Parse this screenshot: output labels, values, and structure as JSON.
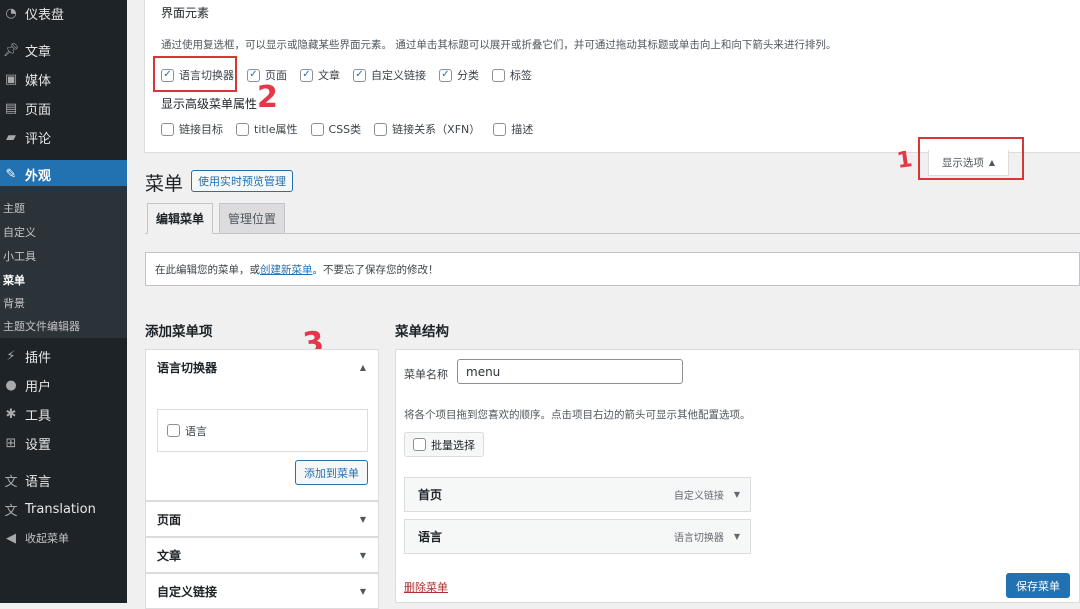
{
  "sidebar": {
    "dashboard": "仪表盘",
    "posts": "文章",
    "media": "媒体",
    "pages": "页面",
    "comments": "评论",
    "appearance": "外观",
    "sub": [
      "主题",
      "自定义",
      "小工具",
      "菜单",
      "背景",
      "主题文件编辑器"
    ],
    "plugins": "插件",
    "users": "用户",
    "tools": "工具",
    "settings": "设置",
    "languages": "语言",
    "translation": "Translation",
    "collapse": "收起菜单"
  },
  "screen_options": {
    "title": "界面元素",
    "desc": "通过使用复选框，可以显示或隐藏某些界面元素。 通过单击其标题可以展开或折叠它们，并可通过拖动其标题或单击向上和向下箭头来进行排列。",
    "boxes": [
      {
        "label": "语言切换器",
        "checked": true
      },
      {
        "label": "页面",
        "checked": true
      },
      {
        "label": "文章",
        "checked": true
      },
      {
        "label": "自定义链接",
        "checked": true
      },
      {
        "label": "分类",
        "checked": true
      },
      {
        "label": "标签",
        "checked": false
      }
    ],
    "advanced_title": "显示高级菜单属性",
    "advanced": [
      {
        "label": "链接目标",
        "checked": false
      },
      {
        "label": "title属性",
        "checked": false
      },
      {
        "label": "CSS类",
        "checked": false
      },
      {
        "label": "链接关系（XFN）",
        "checked": false
      },
      {
        "label": "描述",
        "checked": false
      }
    ],
    "toggle_label": "显示选项"
  },
  "annotations": {
    "one": "1",
    "two": "2",
    "three": "3"
  },
  "page": {
    "title": "菜单",
    "preview_button": "使用实时预览管理"
  },
  "tabs": [
    "编辑菜单",
    "管理位置"
  ],
  "notice": {
    "before": "在此编辑您的菜单，或",
    "link": "创建新菜单",
    "after": "。不要忘了保存您的修改！"
  },
  "add_items": {
    "title": "添加菜单项",
    "open_section": "语言切换器",
    "lang_item": "语言",
    "add_button": "添加到菜单",
    "sections": [
      "页面",
      "文章",
      "自定义链接"
    ]
  },
  "structure": {
    "title": "菜单结构",
    "name_label": "菜单名称",
    "name_value": "menu",
    "help": "将各个项目拖到您喜欢的顺序。点击项目右边的箭头可显示其他配置选项。",
    "bulk_label": "批量选择",
    "items": [
      {
        "title": "首页",
        "type": "自定义链接"
      },
      {
        "title": "语言",
        "type": "语言切换器"
      }
    ],
    "delete_label": "删除菜单",
    "save_label": "保存菜单"
  }
}
